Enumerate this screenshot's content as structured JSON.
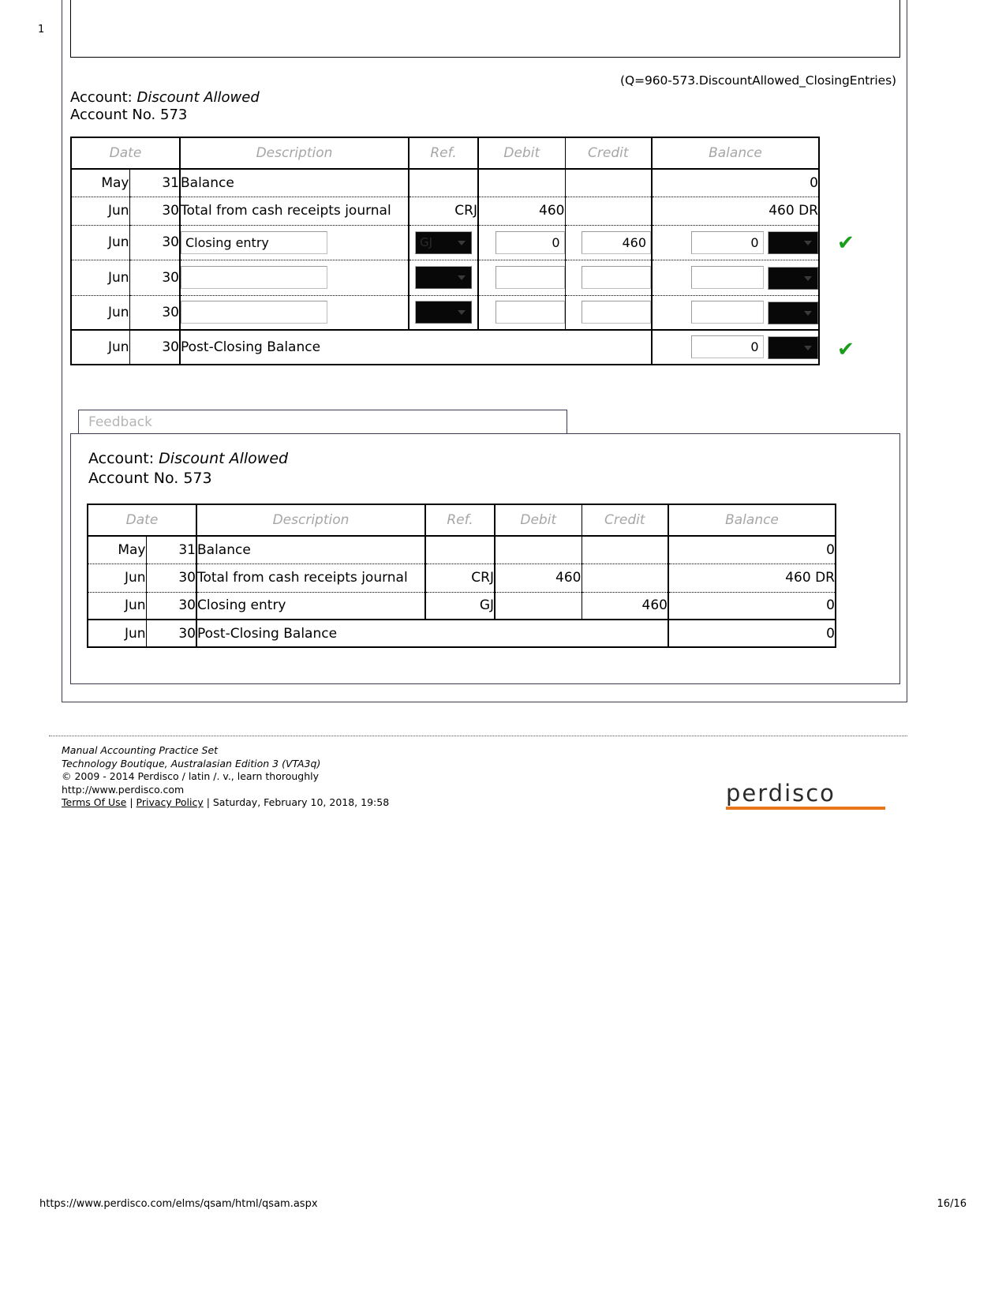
{
  "page": {
    "page_marker": "1",
    "question_code": "(Q=960-573.DiscountAllowed_ClosingEntries)",
    "footer_url": "https://www.perdisco.com/elms/qsam/html/qsam.aspx",
    "footer_page_num": "16/16"
  },
  "account": {
    "label": "Account:",
    "name": "Discount Allowed",
    "number_label": "Account No. 573"
  },
  "columns": {
    "date": "Date",
    "description": "Description",
    "ref": "Ref.",
    "debit": "Debit",
    "credit": "Credit",
    "balance": "Balance"
  },
  "ledger": {
    "rows": [
      {
        "month": "May",
        "day": "31",
        "description": "Balance",
        "ref": "",
        "debit": "",
        "credit": "",
        "balance": "0",
        "editable": false,
        "checked": false
      },
      {
        "month": "Jun",
        "day": "30",
        "description": "Total from cash receipts journal",
        "ref": "CRJ",
        "debit": "460",
        "credit": "",
        "balance": "460 DR",
        "editable": false,
        "checked": false
      },
      {
        "month": "Jun",
        "day": "30",
        "description": "Closing entry",
        "ref": "GJ",
        "debit": "0",
        "credit": "460",
        "balance": "0",
        "balance_dc": "",
        "editable": true,
        "checked": true
      },
      {
        "month": "Jun",
        "day": "30",
        "description": "",
        "ref": "",
        "debit": "",
        "credit": "",
        "balance": "",
        "balance_dc": "",
        "editable": true,
        "checked": false
      },
      {
        "month": "Jun",
        "day": "30",
        "description": "",
        "ref": "",
        "debit": "",
        "credit": "",
        "balance": "",
        "balance_dc": "",
        "editable": true,
        "checked": false
      }
    ],
    "post_closing": {
      "month": "Jun",
      "day": "30",
      "description": "Post-Closing Balance",
      "balance": "0",
      "balance_dc": "",
      "checked": true
    }
  },
  "feedback": {
    "tab_label": "Feedback",
    "account": {
      "label": "Account:",
      "name": "Discount Allowed",
      "number_label": "Account No. 573"
    },
    "rows": [
      {
        "month": "May",
        "day": "31",
        "description": "Balance",
        "ref": "",
        "debit": "",
        "credit": "",
        "balance": "0"
      },
      {
        "month": "Jun",
        "day": "30",
        "description": "Total from cash receipts journal",
        "ref": "CRJ",
        "debit": "460",
        "credit": "",
        "balance": "460 DR"
      },
      {
        "month": "Jun",
        "day": "30",
        "description": "Closing entry",
        "ref": "GJ",
        "debit": "",
        "credit": "460",
        "balance": "0"
      }
    ],
    "post_closing": {
      "month": "Jun",
      "day": "30",
      "description": "Post-Closing Balance",
      "balance": "0"
    }
  },
  "footer": {
    "line1": "Manual Accounting Practice Set",
    "line2": "Technology Boutique, Australasian Edition 3 (VTA3q)",
    "line3": "© 2009 - 2014 Perdisco / latin /. v., learn thoroughly",
    "line4": "http://www.perdisco.com",
    "terms_label": "Terms Of Use",
    "separator1": " | ",
    "privacy_label": "Privacy Policy",
    "separator2": " | Saturday, February 10, 2018, 19:58",
    "logo_text": "perdisco",
    "accent_color": "#e8761a"
  }
}
